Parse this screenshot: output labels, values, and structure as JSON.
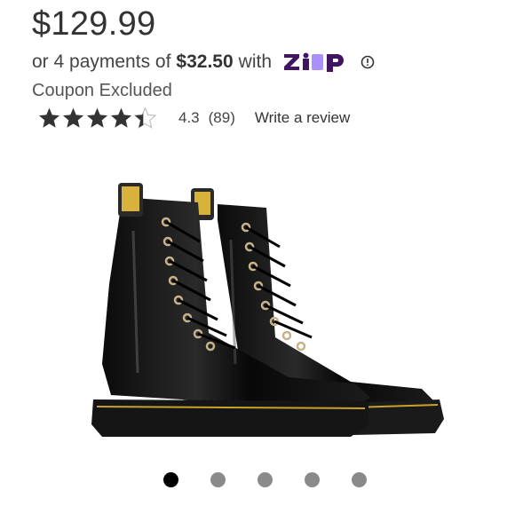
{
  "product": {
    "price": "$129.99",
    "installments": {
      "prefix": "or 4 payments of",
      "amount": "$32.50",
      "suffix": "with",
      "provider_icon": "zip-logo",
      "brand_color": "#411361",
      "accent_color": "#aa8fff"
    },
    "coupon_note": "Coupon Excluded",
    "rating": {
      "stars": 4.3,
      "value": "4.3",
      "count": "(89)",
      "write_review_label": "Write a review",
      "star_color": "#333333"
    }
  },
  "gallery": {
    "image_icon": "black-patent-lace-up-boots",
    "dots": 5,
    "active_index": 0
  }
}
